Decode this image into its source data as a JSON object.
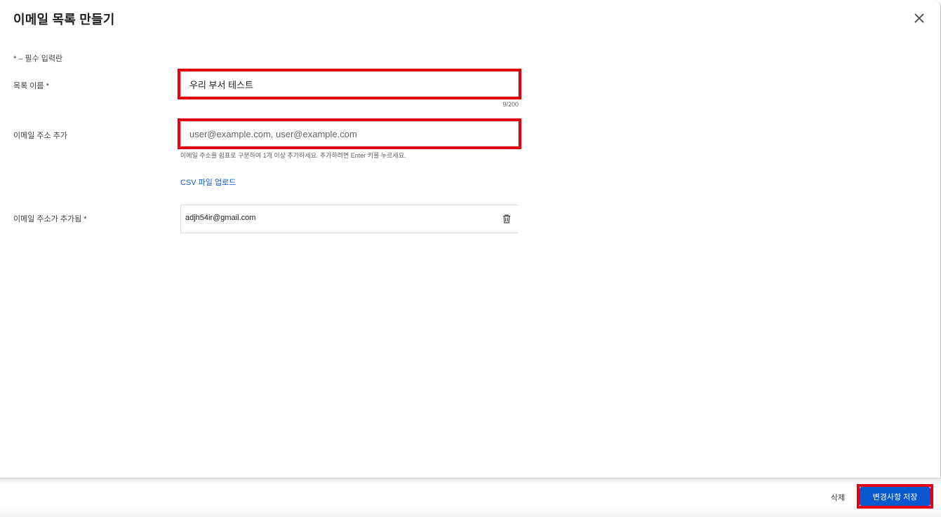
{
  "dialog": {
    "title": "이메일 목록 만들기",
    "close_icon": "close-icon"
  },
  "form": {
    "required_note": "* – 필수 입력란",
    "list_name": {
      "label": "목록 이름  *",
      "value": "우리 부서 테스트",
      "counter": "9/200"
    },
    "add_emails": {
      "label": "이메일 주소 추가",
      "placeholder": "user@example.com, user@example.com",
      "helper": "이메일 주소를 쉼표로 구분하여 1개 이상 추가하세요. 추가하려면 Enter 키를 누르세요."
    },
    "csv_upload_link": "CSV 파일 업로드",
    "added_emails": {
      "label": "이메일 주소가 추가됨  *",
      "items": [
        {
          "email": "adjh54ir@gmail.com",
          "delete_icon": "trash-icon"
        }
      ]
    }
  },
  "footer": {
    "delete_label": "삭제",
    "save_label": "변경사항 저장"
  },
  "colors": {
    "primary": "#0b57d0",
    "highlight": "#e3000f",
    "border": "#dadce0"
  }
}
